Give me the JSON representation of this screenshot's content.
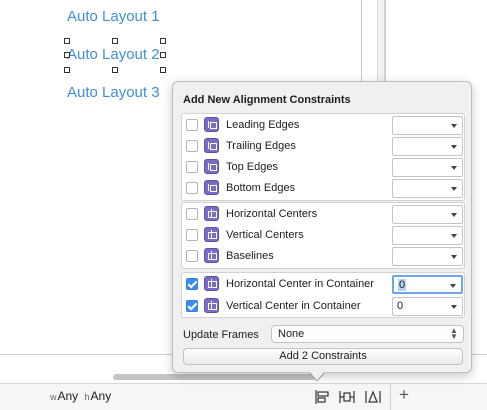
{
  "canvas": {
    "buttons": [
      "Auto Layout 1",
      "Auto Layout 2",
      "Auto Layout 3"
    ]
  },
  "bottom_bar": {
    "width_prefix": "w",
    "width_value": "Any",
    "height_prefix": "h",
    "height_value": "Any",
    "icons": [
      "align-icon",
      "pin-icon",
      "resolve-issues-icon"
    ],
    "add_label": "+"
  },
  "popover": {
    "title": "Add New Alignment Constraints",
    "edge_group": [
      {
        "label": "Leading Edges",
        "checked": false,
        "value": ""
      },
      {
        "label": "Trailing Edges",
        "checked": false,
        "value": ""
      },
      {
        "label": "Top Edges",
        "checked": false,
        "value": ""
      },
      {
        "label": "Bottom Edges",
        "checked": false,
        "value": ""
      }
    ],
    "center_group": [
      {
        "label": "Horizontal Centers",
        "checked": false,
        "value": ""
      },
      {
        "label": "Vertical Centers",
        "checked": false,
        "value": ""
      },
      {
        "label": "Baselines",
        "checked": false,
        "value": ""
      }
    ],
    "container_group": [
      {
        "label": "Horizontal Center in Container",
        "checked": true,
        "value": "0"
      },
      {
        "label": "Vertical Center in Container",
        "checked": true,
        "value": "0"
      }
    ],
    "update_frames_label": "Update Frames",
    "update_frames_value": "None",
    "add_button": "Add 2 Constraints"
  },
  "colors": {
    "link_blue": "#3f8fd7",
    "checkbox_blue": "#3b8ff0",
    "constraint_icon_purple": "#7a6cc4"
  }
}
